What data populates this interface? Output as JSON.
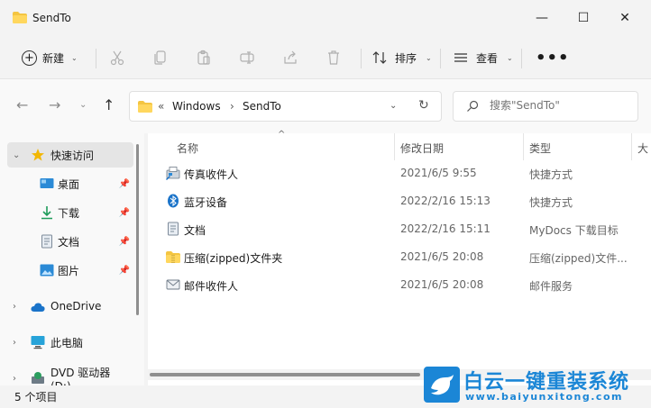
{
  "window": {
    "title": "SendTo",
    "controls": {
      "minimize": "—",
      "maximize": "☐",
      "close": "✕"
    }
  },
  "toolbar": {
    "new_label": "新建",
    "sort_label": "排序",
    "view_label": "查看",
    "more_label": "•••"
  },
  "address": {
    "overflow": "«",
    "segments": [
      "Windows",
      "SendTo"
    ],
    "separator": "›"
  },
  "search": {
    "placeholder": "搜索\"SendTo\""
  },
  "sidebar": {
    "items": [
      {
        "label": "快速访问",
        "icon": "star-icon"
      },
      {
        "label": "桌面",
        "icon": "desktop-icon",
        "pinned": true
      },
      {
        "label": "下载",
        "icon": "download-icon",
        "pinned": true
      },
      {
        "label": "文档",
        "icon": "document-icon",
        "pinned": true
      },
      {
        "label": "图片",
        "icon": "picture-icon",
        "pinned": true
      },
      {
        "label": "OneDrive",
        "icon": "cloud-icon"
      },
      {
        "label": "此电脑",
        "icon": "computer-icon"
      },
      {
        "label": "DVD 驱动器 (D:)",
        "icon": "dvd-icon"
      }
    ]
  },
  "columns": {
    "name": "名称",
    "date": "修改日期",
    "type": "类型",
    "size": "大"
  },
  "files": [
    {
      "name": "传真收件人",
      "date": "2021/6/5 9:55",
      "type": "快捷方式",
      "icon": "fax-icon"
    },
    {
      "name": "蓝牙设备",
      "date": "2022/2/16 15:13",
      "type": "快捷方式",
      "icon": "bluetooth-icon"
    },
    {
      "name": "文档",
      "date": "2022/2/16 15:11",
      "type": "MyDocs 下载目标",
      "icon": "document-icon"
    },
    {
      "name": "压缩(zipped)文件夹",
      "date": "2021/6/5 20:08",
      "type": "压缩(zipped)文件...",
      "icon": "zip-folder-icon"
    },
    {
      "name": "邮件收件人",
      "date": "2021/6/5 20:08",
      "type": "邮件服务",
      "icon": "mail-icon"
    }
  ],
  "status": {
    "count": "5 个项目"
  },
  "watermark": {
    "text_cn": "白云一键重装系统",
    "url": "www.baiyunxitong.com"
  },
  "colors": {
    "accent": "#1b86d6",
    "folder": "#f4c542"
  }
}
